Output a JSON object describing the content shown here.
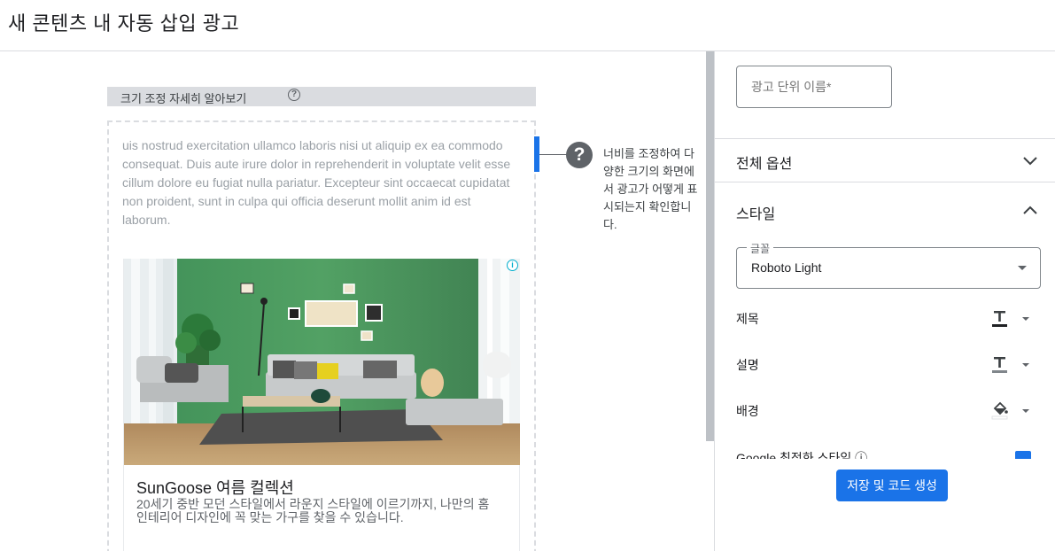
{
  "page": {
    "title": "새 콘텐츠 내 자동 삽입 광고"
  },
  "preview": {
    "resize_label": "크기 조정 자세히 알아보기",
    "hint_text": "너비를 조정하여 다양한 크기의 화면에서 광고가 어떻게 표시되는지 확인합니다.",
    "lorem": "uis nostrud exercitation ullamco laboris nisi ut aliquip ex ea commodo consequat. Duis aute irure dolor in reprehenderit in voluptate velit esse cillum dolore eu fugiat nulla pariatur. Excepteur sint occaecat cupidatat non proident, sunt in culpa qui officia deserunt mollit anim id est laborum.",
    "ad": {
      "title": "SunGoose 여름 컬렉션",
      "description": "20세기 중반 모던 스타일에서 라운지 스타일에 이르기까지, 나만의 홈 인테리어 디자인에 꼭 맞는 가구를 찾을 수 있습니다."
    }
  },
  "settings": {
    "ad_unit_name_placeholder": "광고 단위 이름*",
    "sections": {
      "global_options": "전체 옵션",
      "style": "스타일"
    },
    "font": {
      "legend": "글꼴",
      "value": "Roboto Light"
    },
    "rows": {
      "title": "제목",
      "description": "설명",
      "background": "배경",
      "google_optimized": "Google 최적화 스타일 ⓘ"
    },
    "save_button": "저장 및 코드 생성"
  },
  "colors": {
    "accent": "#1a73e8",
    "title_swatch": "#202124",
    "desc_swatch": "#80868b"
  }
}
